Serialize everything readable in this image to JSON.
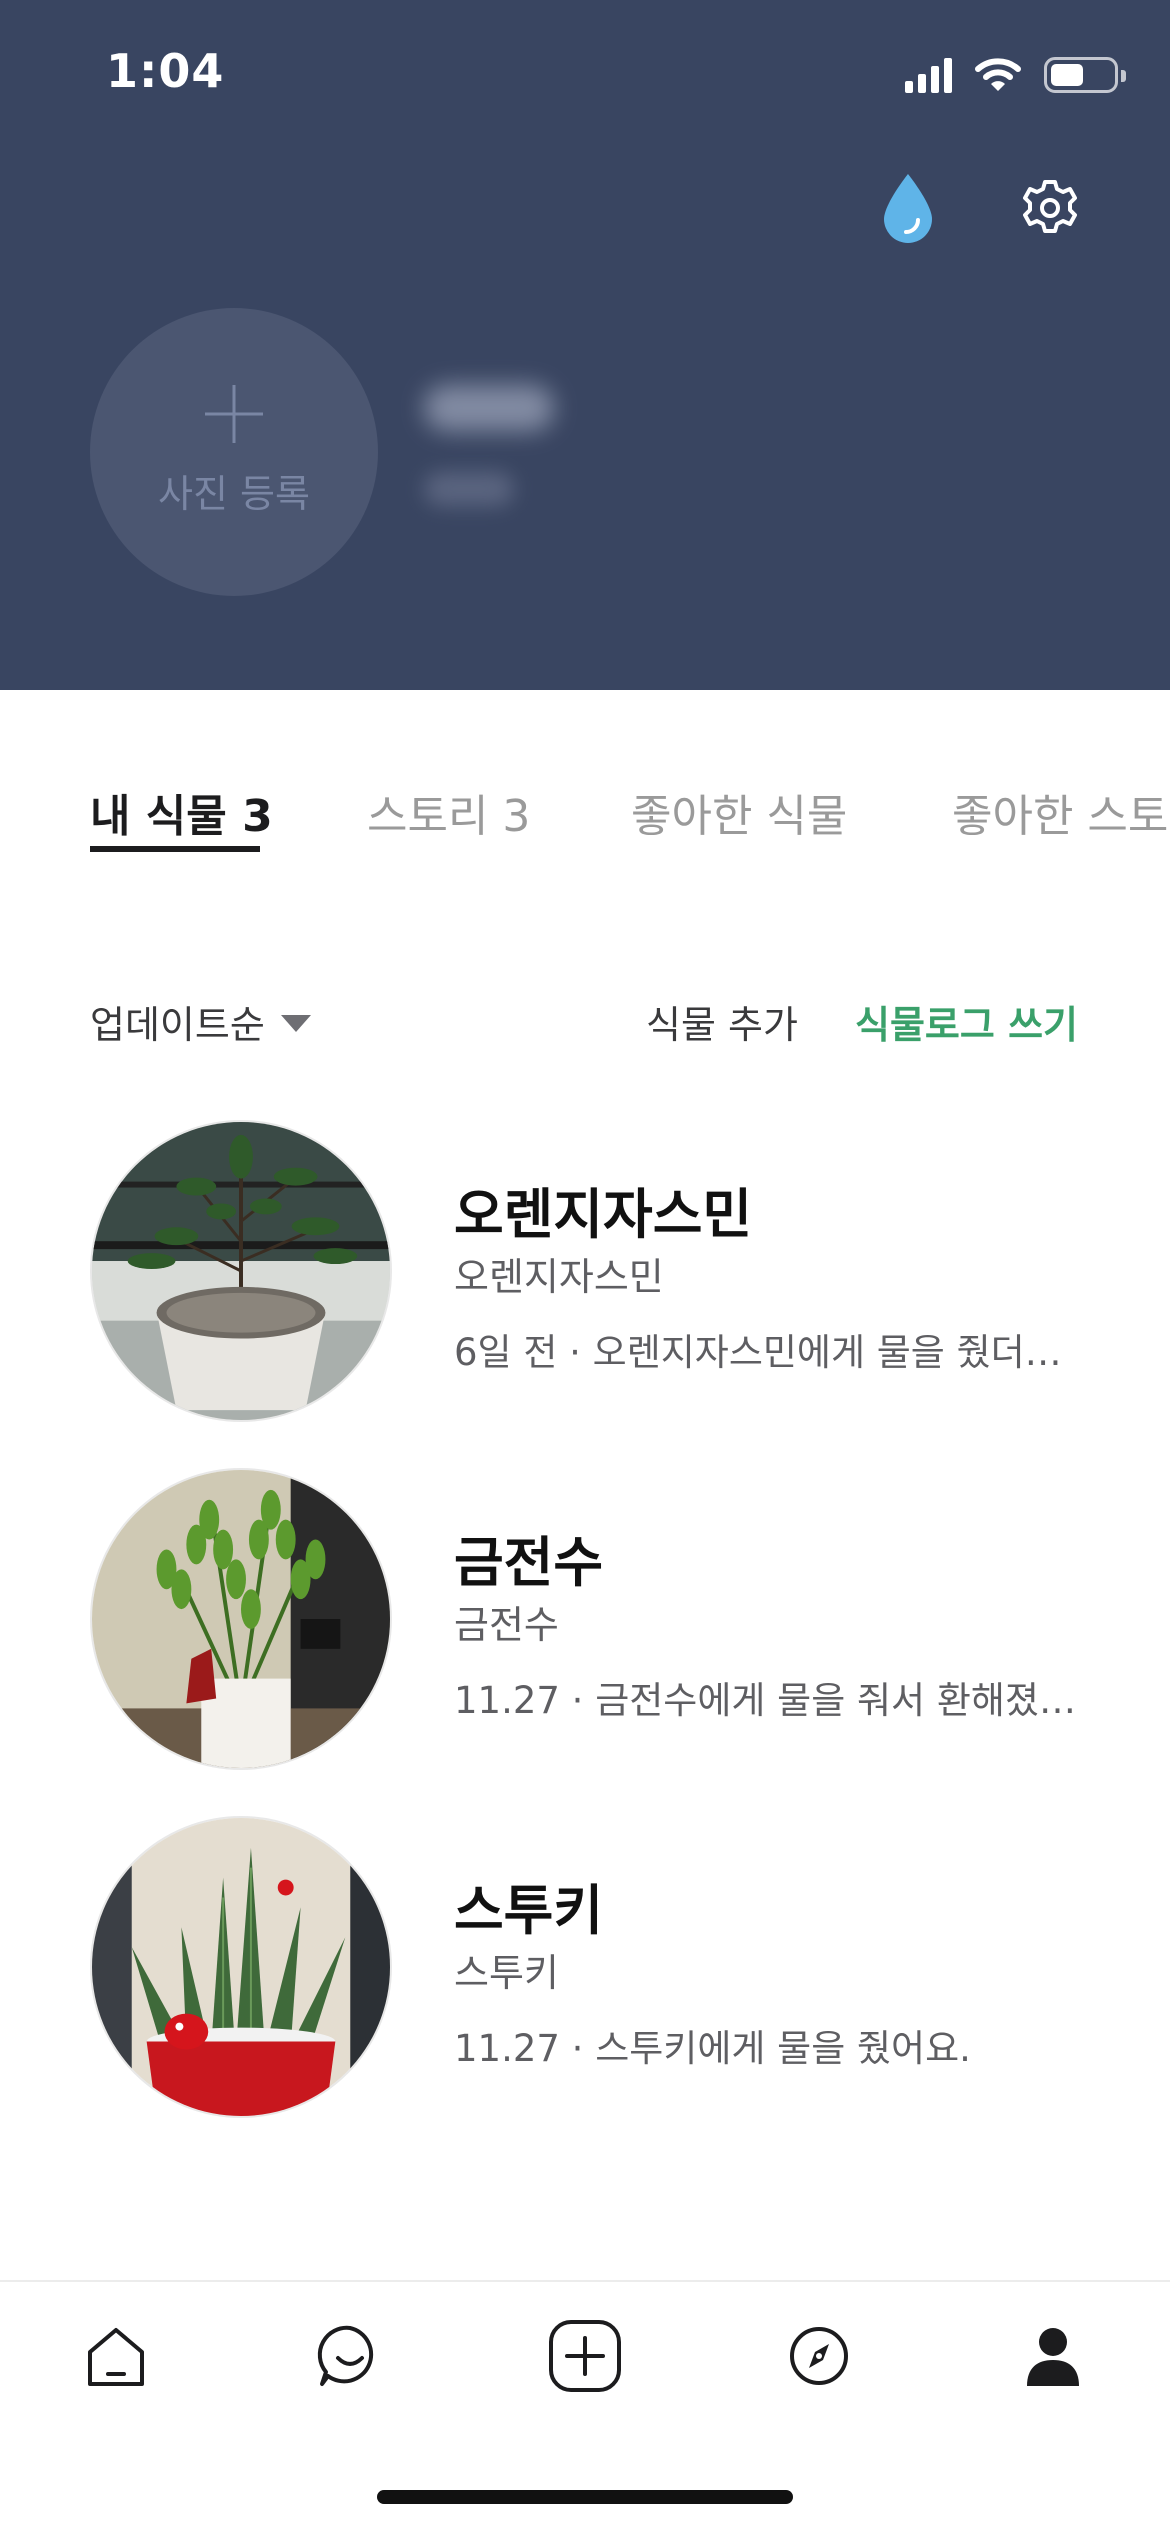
{
  "status_bar": {
    "time": "1:04"
  },
  "header": {
    "avatar_label": "사진 등록",
    "icons": {
      "water": "water-drop-icon",
      "settings": "gear-icon"
    },
    "colors": {
      "background": "#394561",
      "water_icon": "#5fb4e8"
    }
  },
  "tabs": [
    {
      "label": "내 식물 3",
      "active": true
    },
    {
      "label": "스토리 3",
      "active": false
    },
    {
      "label": "좋아한 식물",
      "active": false
    },
    {
      "label": "좋아한 스토리",
      "active": false
    }
  ],
  "toolbar": {
    "sort_label": "업데이트순",
    "add_plant": "식물 추가",
    "write_log": "식물로그 쓰기",
    "accent_color": "#3aa06a"
  },
  "plants": [
    {
      "name": "오렌지자스민",
      "species": "오렌지자스민",
      "log": "6일 전 · 오렌지자스민에게 물을 줬더…"
    },
    {
      "name": "금전수",
      "species": "금전수",
      "log": "11.27 · 금전수에게 물을 줘서 환해졌…"
    },
    {
      "name": "스투키",
      "species": "스투키",
      "log": "11.27 · 스투키에게 물을 줬어요."
    }
  ],
  "bottom_nav": [
    {
      "icon": "home-icon",
      "active": false
    },
    {
      "icon": "chat-smile-icon",
      "active": false
    },
    {
      "icon": "add-square-icon",
      "active": false
    },
    {
      "icon": "compass-icon",
      "active": false
    },
    {
      "icon": "profile-icon",
      "active": true
    }
  ]
}
